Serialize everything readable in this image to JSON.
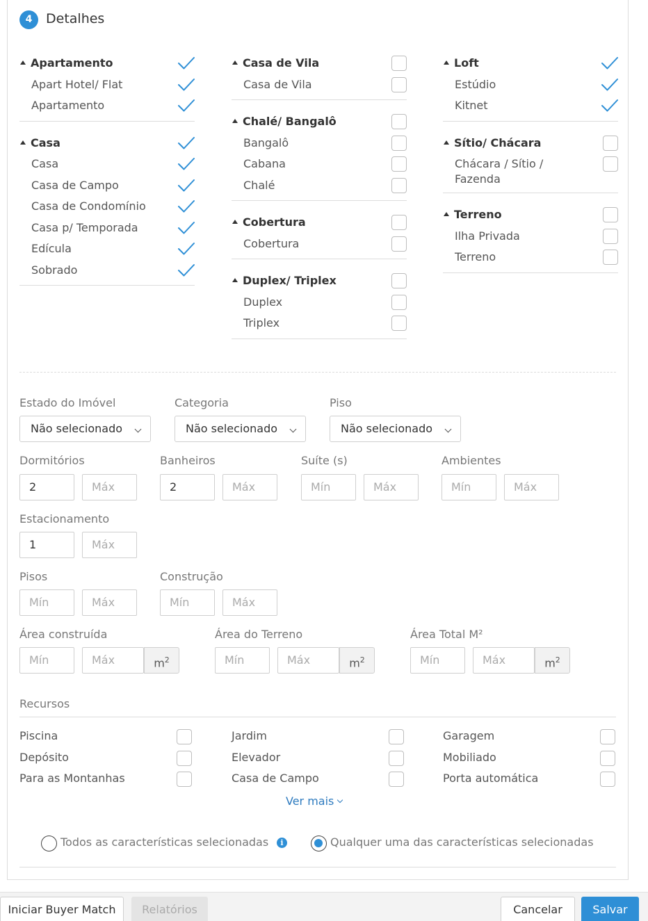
{
  "section": {
    "step": "4",
    "title": "Detalhes"
  },
  "property_types": {
    "col1": [
      {
        "parent": {
          "label": "Apartamento",
          "checked": true
        },
        "children": [
          {
            "label": "Apart Hotel/ Flat",
            "checked": true
          },
          {
            "label": "Apartamento",
            "checked": true
          }
        ]
      },
      {
        "parent": {
          "label": "Casa",
          "checked": true
        },
        "children": [
          {
            "label": "Casa",
            "checked": true
          },
          {
            "label": "Casa de Campo",
            "checked": true
          },
          {
            "label": "Casa de Condomínio",
            "checked": true
          },
          {
            "label": "Casa p/ Temporada",
            "checked": true
          },
          {
            "label": "Edícula",
            "checked": true
          },
          {
            "label": "Sobrado",
            "checked": true
          }
        ]
      }
    ],
    "col2": [
      {
        "parent": {
          "label": "Casa de Vila",
          "checked": false
        },
        "children": [
          {
            "label": "Casa de Vila",
            "checked": false
          }
        ]
      },
      {
        "parent": {
          "label": "Chalé/ Bangalô",
          "checked": false
        },
        "children": [
          {
            "label": "Bangalô",
            "checked": false
          },
          {
            "label": "Cabana",
            "checked": false
          },
          {
            "label": "Chalé",
            "checked": false
          }
        ]
      },
      {
        "parent": {
          "label": "Cobertura",
          "checked": false
        },
        "children": [
          {
            "label": "Cobertura",
            "checked": false
          }
        ]
      },
      {
        "parent": {
          "label": "Duplex/ Triplex",
          "checked": false
        },
        "children": [
          {
            "label": "Duplex",
            "checked": false
          },
          {
            "label": "Triplex",
            "checked": false
          }
        ]
      }
    ],
    "col3": [
      {
        "parent": {
          "label": "Loft",
          "checked": true
        },
        "children": [
          {
            "label": "Estúdio",
            "checked": true
          },
          {
            "label": "Kitnet",
            "checked": true
          }
        ]
      },
      {
        "parent": {
          "label": "Sítio/ Chácara",
          "checked": false
        },
        "children": [
          {
            "label": "Chácara / Sítio / Fazenda",
            "checked": false
          }
        ]
      },
      {
        "parent": {
          "label": "Terreno",
          "checked": false
        },
        "children": [
          {
            "label": "Ilha Privada",
            "checked": false
          },
          {
            "label": "Terreno",
            "checked": false
          }
        ]
      }
    ]
  },
  "filters": {
    "estado": {
      "label": "Estado do Imóvel",
      "value": "Não selecionado"
    },
    "categoria": {
      "label": "Categoria",
      "value": "Não selecionado"
    },
    "piso": {
      "label": "Piso",
      "value": "Não selecionado"
    },
    "dormitorios": {
      "label": "Dormitórios",
      "min": "2",
      "max_placeholder": "Máx"
    },
    "banheiros": {
      "label": "Banheiros",
      "min": "2",
      "max_placeholder": "Máx"
    },
    "suites": {
      "label": "Suíte (s)",
      "min_placeholder": "Mín",
      "max_placeholder": "Máx"
    },
    "ambientes": {
      "label": "Ambientes",
      "min_placeholder": "Mín",
      "max_placeholder": "Máx"
    },
    "estacionamento": {
      "label": "Estacionamento",
      "min": "1",
      "max_placeholder": "Máx"
    },
    "pisos": {
      "label": "Pisos",
      "min_placeholder": "Mín",
      "max_placeholder": "Máx"
    },
    "construcao": {
      "label": "Construção",
      "min_placeholder": "Mín",
      "max_placeholder": "Máx"
    },
    "area_construida": {
      "label": "Área construída",
      "min_placeholder": "Mín",
      "max_placeholder": "Máx",
      "unit": "m",
      "unit_sup": "2"
    },
    "area_terreno": {
      "label": "Área do Terreno",
      "min_placeholder": "Mín",
      "max_placeholder": "Máx",
      "unit": "m",
      "unit_sup": "2"
    },
    "area_total": {
      "label": "Área Total M²",
      "min_placeholder": "Mín",
      "max_placeholder": "Máx",
      "unit": "m",
      "unit_sup": "2"
    }
  },
  "recursos": {
    "title": "Recursos",
    "items": [
      "Piscina",
      "Depósito",
      "Para as Montanhas",
      "Jardim",
      "Elevador",
      "Casa de Campo",
      "Garagem",
      "Mobiliado",
      "Porta automática"
    ],
    "ver_mais": "Ver mais"
  },
  "match_mode": {
    "all": "Todos as características selecionadas",
    "any": "Qualquer uma das características selecionadas",
    "selected": "any",
    "info_icon": "i"
  },
  "footer": {
    "buyer_match": "Iniciar Buyer Match",
    "relatorios": "Relatórios",
    "cancelar": "Cancelar",
    "salvar": "Salvar"
  },
  "colors": {
    "accent": "#2e8fd6",
    "link": "#2e7bbf"
  }
}
